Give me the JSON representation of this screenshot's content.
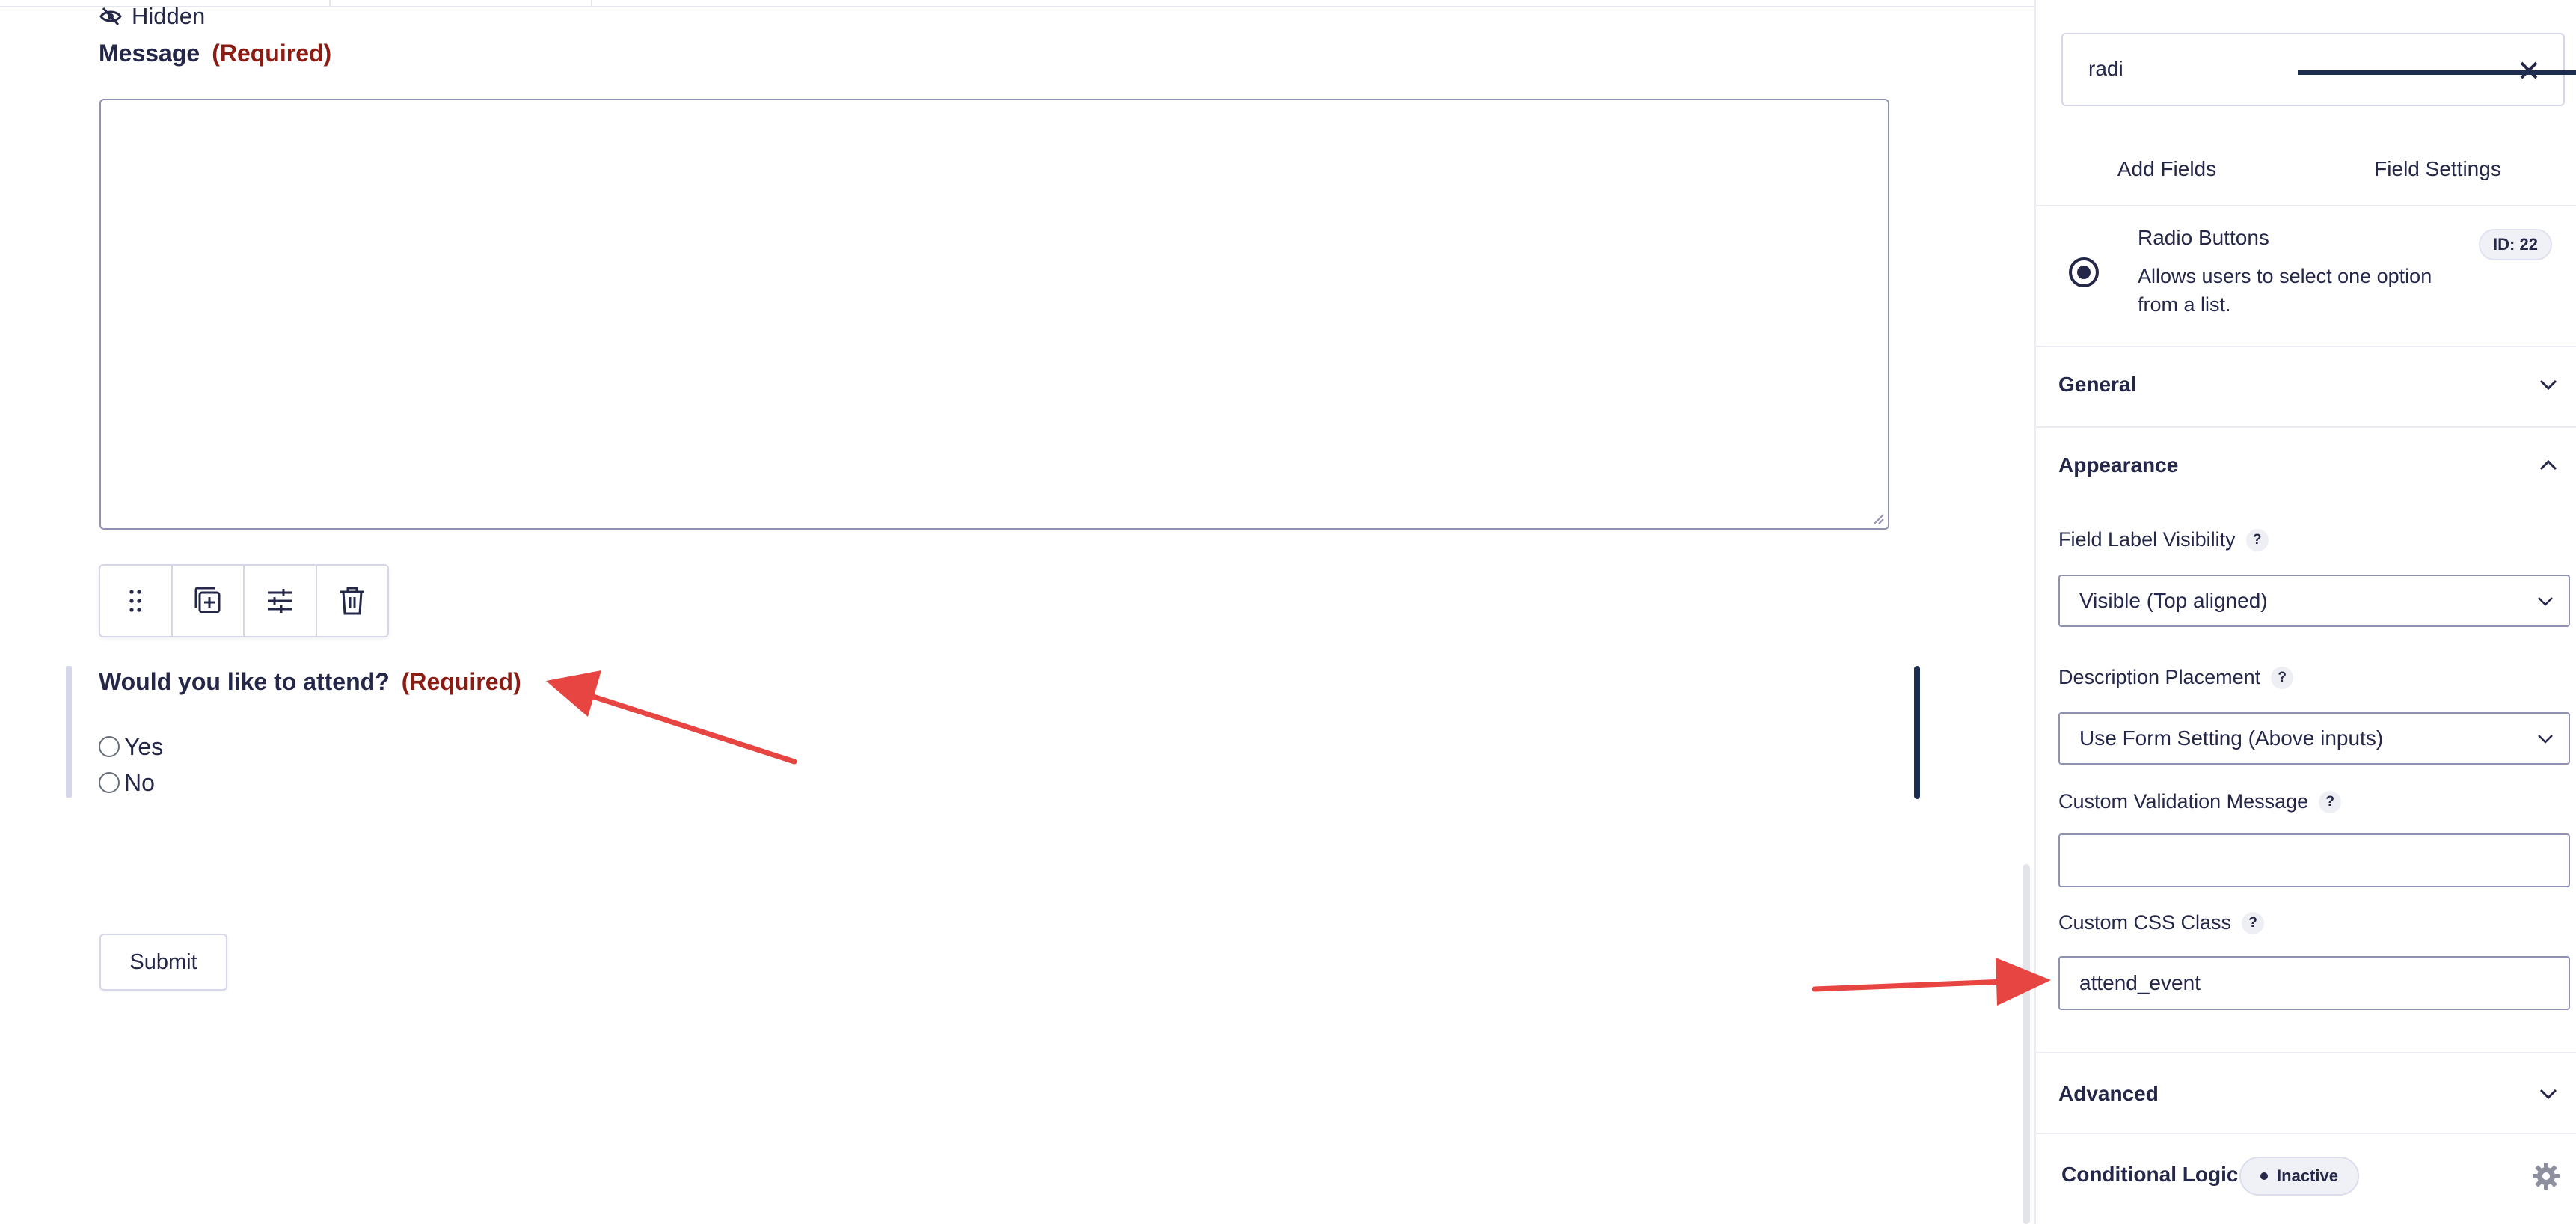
{
  "canvas": {
    "hidden_text": "Hidden",
    "message_field": {
      "label": "Message",
      "required": "(Required)"
    },
    "attend_field": {
      "label": "Would you like to attend?",
      "required": "(Required)",
      "options": [
        "Yes",
        "No"
      ]
    },
    "submit_label": "Submit",
    "toolbar_icons": [
      "drag-handle-icon",
      "duplicate-icon",
      "settings-sliders-icon",
      "trash-icon"
    ]
  },
  "sidebar": {
    "search": {
      "value": "radi"
    },
    "tabs": [
      {
        "label": "Add Fields",
        "active": false
      },
      {
        "label": "Field Settings",
        "active": true
      }
    ],
    "field": {
      "title": "Radio Buttons",
      "description": "Allows users to select one option from a list.",
      "id_badge": "ID: 22"
    },
    "sections": {
      "general": "General",
      "appearance": "Appearance",
      "advanced": "Advanced"
    },
    "appearance": {
      "label_visibility": {
        "label": "Field Label Visibility",
        "value": "Visible (Top aligned)"
      },
      "description_placement": {
        "label": "Description Placement",
        "value": "Use Form Setting (Above inputs)"
      },
      "validation_message": {
        "label": "Custom Validation Message",
        "value": ""
      },
      "css_class": {
        "label": "Custom CSS Class",
        "value": "attend_event"
      },
      "help": "?"
    },
    "conditional_logic": {
      "label": "Conditional Logic",
      "status": "Inactive"
    }
  },
  "colors": {
    "text": "#242748",
    "required": "#8a1c14",
    "accent": "#1d2d4f",
    "arrow": "#e64542",
    "border": "#d5d7e9"
  }
}
